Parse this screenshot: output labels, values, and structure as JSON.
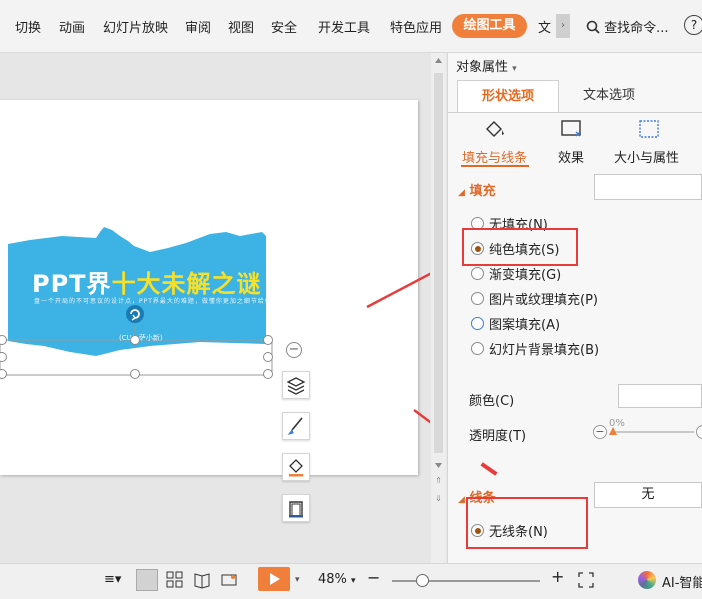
{
  "menu": {
    "items": [
      "切换",
      "动画",
      "幻灯片放映",
      "审阅",
      "视图",
      "安全",
      "开发工具",
      "特色应用"
    ],
    "active": "绘图工具",
    "overflow": "文",
    "search": "查找命令...",
    "help": "?"
  },
  "slide": {
    "title_part1": "PPT界",
    "title_part2": "十大未解之谜",
    "subtitle": "盘一个开局的不可思议的设计点，PPT界最大的难题，做懂你更加之细节给你",
    "caption": "(CUC 萨小新)"
  },
  "panel": {
    "title": "对象属性",
    "tabs": [
      "形状选项",
      "文本选项"
    ],
    "icon_tabs": [
      "填充与线条",
      "效果",
      "大小与属性"
    ],
    "fill": {
      "heading": "填充",
      "options": [
        {
          "label": "无填充(N)",
          "selected": false
        },
        {
          "label": "纯色填充(S)",
          "selected": true
        },
        {
          "label": "渐变填充(G)",
          "selected": false
        },
        {
          "label": "图片或纹理填充(P)",
          "selected": false
        },
        {
          "label": "图案填充(A)",
          "selected": false
        },
        {
          "label": "幻灯片背景填充(B)",
          "selected": false
        }
      ],
      "color_label": "颜色(C)",
      "transparency_label": "透明度(T)",
      "transparency_value": "0%"
    },
    "line": {
      "heading": "线条",
      "value": "无",
      "option": "无线条(N)"
    }
  },
  "status": {
    "zoom": "48%",
    "ai_label": "AI-智能"
  },
  "colors": {
    "accent": "#ef7f3a",
    "banner": "#3cb3e4",
    "highlight": "#e83c3c",
    "title_yellow": "#f5e02a"
  }
}
